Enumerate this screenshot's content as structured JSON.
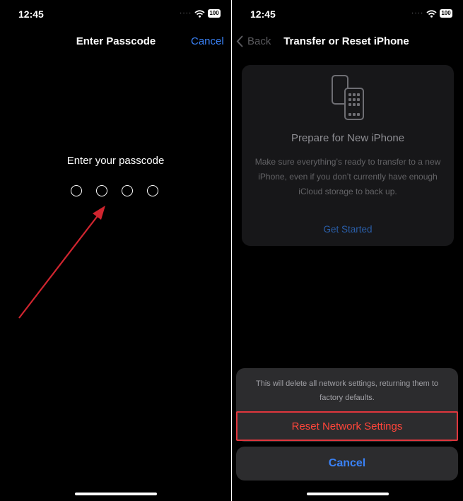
{
  "left": {
    "status": {
      "time": "12:45",
      "battery": "100"
    },
    "nav": {
      "title": "Enter Passcode",
      "cancel": "Cancel"
    },
    "prompt": "Enter your passcode",
    "passcode_length": 4,
    "annotation_color": "#d0252f"
  },
  "right": {
    "status": {
      "time": "12:45",
      "battery": "100"
    },
    "nav": {
      "back": "Back",
      "title": "Transfer or Reset iPhone"
    },
    "card": {
      "title": "Prepare for New iPhone",
      "body": "Make sure everything’s ready to transfer to a new iPhone, even if you don’t currently have enough iCloud storage to back up.",
      "link": "Get Started"
    },
    "sheet": {
      "message": "This will delete all network settings, returning them to factory defaults.",
      "reset": "Reset Network Settings",
      "cancel": "Cancel"
    },
    "colors": {
      "accent": "#3a82f7",
      "destructive": "#ff453a",
      "highlight_border": "#e0363d"
    }
  }
}
